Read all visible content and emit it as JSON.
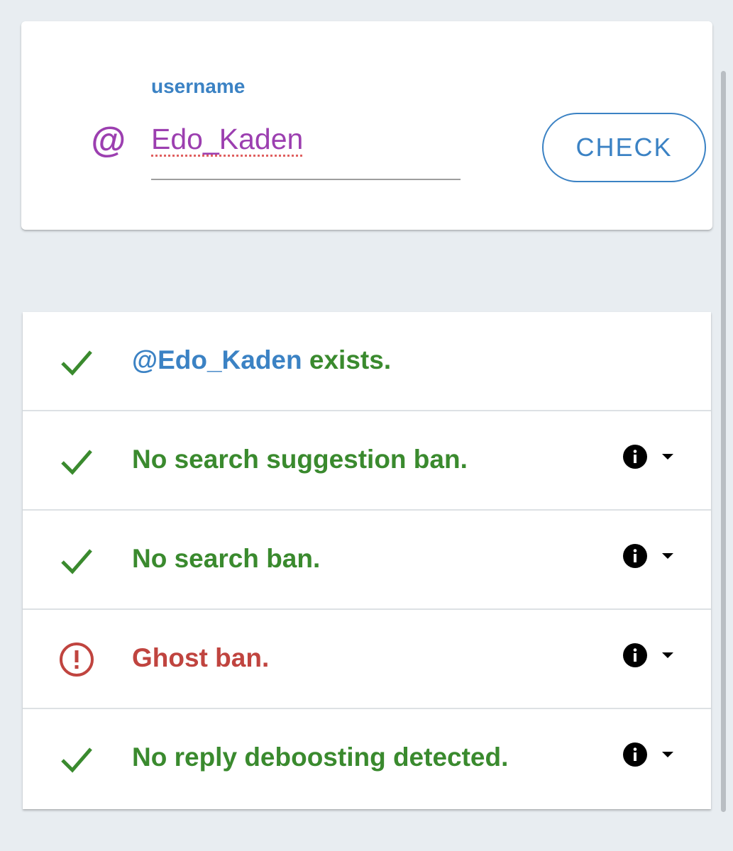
{
  "input_card": {
    "label": "username",
    "at_symbol": "@",
    "username_value": "Edo_Kaden",
    "check_label": "CHECK"
  },
  "results": {
    "rows": [
      {
        "status": "ok",
        "handle": "@Edo_Kaden",
        "text": " exists.",
        "has_info": false
      },
      {
        "status": "ok",
        "text": "No search suggestion ban.",
        "has_info": true
      },
      {
        "status": "ok",
        "text": "No search ban.",
        "has_info": true
      },
      {
        "status": "bad",
        "text": "Ghost ban.",
        "has_info": true
      },
      {
        "status": "ok",
        "text": "No reply deboosting detected.",
        "has_info": true
      }
    ]
  },
  "colors": {
    "accent_blue": "#3b82c4",
    "accent_purple": "#9c3fb0",
    "ok_green": "#3a8a2e",
    "bad_red": "#c0443f",
    "background": "#e8edf1"
  },
  "icons": {
    "ok": "check-icon",
    "bad": "alert-circle-icon",
    "info": "info-icon",
    "expand": "caret-down-icon",
    "at": "at-icon"
  }
}
